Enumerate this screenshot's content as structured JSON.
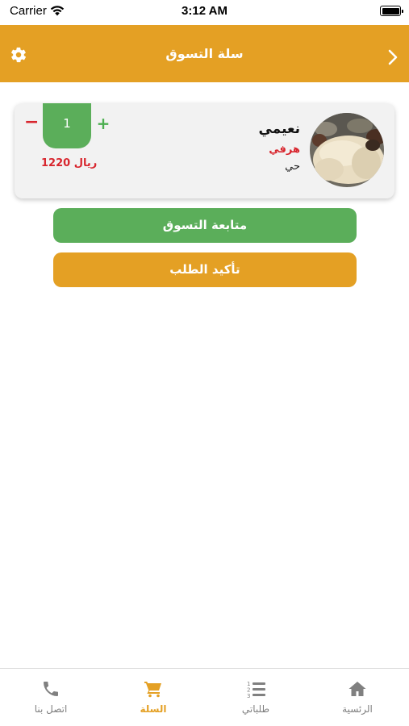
{
  "status_bar": {
    "carrier": "Carrier",
    "time": "3:12 AM"
  },
  "header": {
    "title": "سلة التسوق",
    "settings_icon": "gear-icon",
    "back_icon": "chevron-right-icon"
  },
  "cart_item": {
    "name": "نعيمي",
    "cut": "هرفي",
    "type": "حي",
    "quantity": "1",
    "minus": "−",
    "plus": "+",
    "price": "1220 ريال"
  },
  "buttons": {
    "continue_shopping": "متابعة التسوق",
    "confirm_order": "تأكيد الطلب"
  },
  "tabbar": {
    "items": [
      {
        "label": "اتصل بنا",
        "icon": "phone-icon",
        "active": false
      },
      {
        "label": "السلة",
        "icon": "cart-icon",
        "active": true
      },
      {
        "label": "طلباتي",
        "icon": "list-icon",
        "active": false
      },
      {
        "label": "الرئسية",
        "icon": "home-icon",
        "active": false
      }
    ]
  },
  "colors": {
    "primary": "#E4A024",
    "green": "#5BAE5A",
    "red": "#D8262E",
    "inactive": "#808080"
  }
}
